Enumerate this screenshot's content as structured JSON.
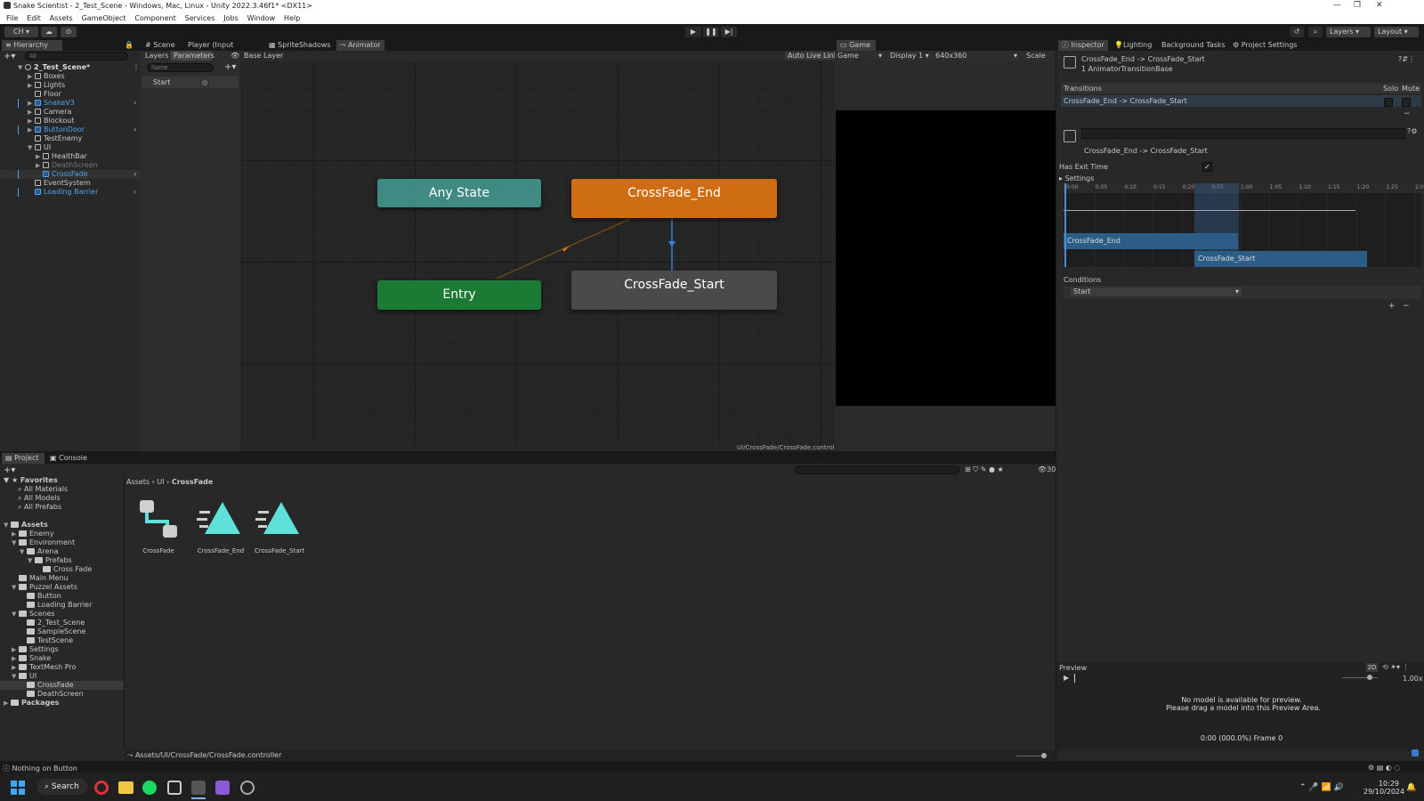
{
  "window": {
    "title": "Snake Scientist - 2_Test_Scene - Windows, Mac, Linux - Unity 2022.3.46f1* <DX11>",
    "controls": [
      "—",
      "❐",
      "✕"
    ]
  },
  "menu": [
    "File",
    "Edit",
    "Assets",
    "GameObject",
    "Component",
    "Services",
    "Jobs",
    "Window",
    "Help"
  ],
  "toolbar": {
    "account": "CH",
    "layers": "Layers",
    "layout": "Layout"
  },
  "hierarchy": {
    "tab": "Hierarchy",
    "search_placeholder": "All",
    "scene": "2_Test_Scene*",
    "items": [
      {
        "label": "Boxes",
        "style": "normal"
      },
      {
        "label": "Lights",
        "style": "normal"
      },
      {
        "label": "Floor",
        "style": "normal"
      },
      {
        "label": "SnakeV3",
        "style": "blue"
      },
      {
        "label": "Camera",
        "style": "normal"
      },
      {
        "label": "Blockout",
        "style": "normal"
      },
      {
        "label": "ButtonDoor",
        "style": "blue"
      },
      {
        "label": "TestEnemy",
        "style": "normal"
      },
      {
        "label": "UI",
        "style": "normal"
      },
      {
        "label": "HealthBar",
        "style": "normal"
      },
      {
        "label": "DeathScreen",
        "style": "dim"
      },
      {
        "label": "CrossFade",
        "style": "blue"
      },
      {
        "label": "EventSystem",
        "style": "normal"
      },
      {
        "label": "Loading Barrier",
        "style": "blue"
      }
    ]
  },
  "center_tabs": [
    "Scene",
    "Player (Input Actions)",
    "SpriteShadows",
    "Animator"
  ],
  "animator": {
    "subtabs": [
      "Layers",
      "Parameters"
    ],
    "search_placeholder": "Name",
    "parameter": "Start",
    "breadcrumb": "Base Layer",
    "auto_live_link": "Auto Live Link",
    "states": {
      "any_state": "Any State",
      "entry": "Entry",
      "end": "CrossFade_End",
      "start": "CrossFade_Start"
    },
    "footer_path": "UI/CrossFade/CrossFade.controller"
  },
  "game": {
    "tab": "Game",
    "dropdown": "Game",
    "display": "Display 1",
    "resolution": "640x360",
    "scale": "Scale"
  },
  "inspector": {
    "tabs": [
      "Inspector",
      "Lighting",
      "Background Tasks",
      "Project Settings"
    ],
    "title": "CrossFade_End -> CrossFade_Start",
    "subtitle": "1 AnimatorTransitionBase",
    "transitions_label": "Transitions",
    "solo": "Solo",
    "mute": "Mute",
    "transition_row": "CrossFade_End -> CrossFade_Start",
    "detail_name": "CrossFade_End -> CrossFade_Start",
    "has_exit_time": "Has Exit Time",
    "settings": "Settings",
    "timeline_ticks": [
      "0:00",
      "0:05",
      "0:10",
      "0:15",
      "0:20",
      "0:25",
      "1:00",
      "1:05",
      "1:10",
      "1:15",
      "1:20",
      "1:25",
      "2:00"
    ],
    "clip_end": "CrossFade_End",
    "clip_start": "CrossFade_Start",
    "conditions": "Conditions",
    "condition_param": "Start",
    "preview": "Preview",
    "preview_msg1": "No model is available for preview.",
    "preview_msg2": "Please drag a model into this Preview Area.",
    "speed": "1.00x",
    "frame": "0:00 (000.0%) Frame 0",
    "twod": "2D"
  },
  "project": {
    "tabs": [
      "Project",
      "Console"
    ],
    "count": "30",
    "breadcrumb": [
      "Assets",
      "UI",
      "CrossFade"
    ],
    "favorites_label": "Favorites",
    "favorites": [
      "All Materials",
      "All Models",
      "All Prefabs"
    ],
    "tree": [
      {
        "label": "Assets",
        "level": 0,
        "bold": true
      },
      {
        "label": "Enemy",
        "level": 1
      },
      {
        "label": "Environment",
        "level": 1
      },
      {
        "label": "Arena",
        "level": 2
      },
      {
        "label": "Prefabs",
        "level": 3
      },
      {
        "label": "Cross Fade",
        "level": 4
      },
      {
        "label": "Main Menu",
        "level": 1
      },
      {
        "label": "Puzzel Assets",
        "level": 1
      },
      {
        "label": "Button",
        "level": 2
      },
      {
        "label": "Loading Barrier",
        "level": 2
      },
      {
        "label": "Scenes",
        "level": 1
      },
      {
        "label": "2_Test_Scene",
        "level": 2
      },
      {
        "label": "SampleScene",
        "level": 2
      },
      {
        "label": "TestScene",
        "level": 2
      },
      {
        "label": "Settings",
        "level": 1
      },
      {
        "label": "Snake",
        "level": 1
      },
      {
        "label": "TextMesh Pro",
        "level": 1
      },
      {
        "label": "UI",
        "level": 1
      },
      {
        "label": "CrossFade",
        "level": 2,
        "selected": true
      },
      {
        "label": "DeathScreen",
        "level": 2
      },
      {
        "label": "Packages",
        "level": 0,
        "bold": true
      }
    ],
    "assets": [
      {
        "label": "CrossFade",
        "icon": "animator-controller-icon"
      },
      {
        "label": "CrossFade_End",
        "icon": "animation-clip-icon"
      },
      {
        "label": "CrossFade_Start",
        "icon": "animation-clip-icon"
      }
    ],
    "footer_path": "Assets/UI/CrossFade/CrossFade.controller"
  },
  "status": "Nothing on Button",
  "taskbar": {
    "search": "Search",
    "time": "10:29",
    "date": "29/10/2024"
  },
  "colors": {
    "any_state": "#3f8b84",
    "entry": "#1b7a33",
    "end_state": "#cf6d12",
    "start_state": "#4a4a4a",
    "selection_blue": "#2c5d87"
  }
}
